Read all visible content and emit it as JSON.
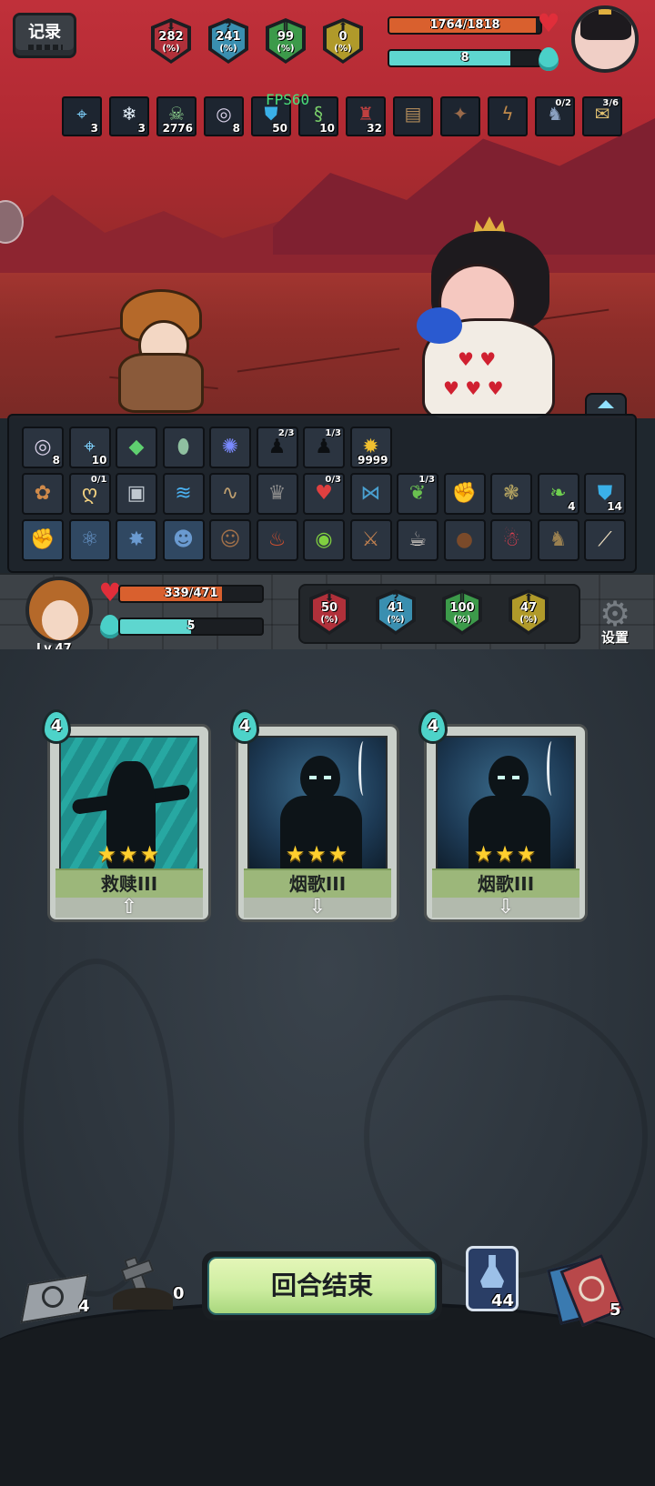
{
  "header": {
    "record_label": "记录",
    "fps": "FPS60"
  },
  "enemy": {
    "hp_text": "1764/1818",
    "hp_fraction": 0.97,
    "energy_value": "8",
    "energy_fraction": 0.8,
    "stats": [
      {
        "value": "282",
        "unit": "(%)",
        "color": "#b0303a",
        "glyph": "⬇",
        "icon": "attack-down-icon"
      },
      {
        "value": "241",
        "unit": "(%)",
        "color": "#3a8fb0",
        "glyph": "?",
        "icon": "mystery-icon"
      },
      {
        "value": "99",
        "unit": "(%)",
        "color": "#3c9a4a",
        "glyph": "⫼",
        "icon": "pillar-icon"
      },
      {
        "value": "0",
        "unit": "(%)",
        "color": "#b09a2a",
        "glyph": "⬆",
        "icon": "attack-up-icon"
      }
    ],
    "status_icons": [
      {
        "icon": "crosshair-icon",
        "glyph": "⌖",
        "count": "3",
        "top": "",
        "color": "#7fd3ff"
      },
      {
        "icon": "snowflake-icon",
        "glyph": "❄",
        "count": "3",
        "top": "",
        "color": "#e8f4ff"
      },
      {
        "icon": "skull-icon",
        "glyph": "☠",
        "count": "2776",
        "top": "",
        "color": "#8fd48f"
      },
      {
        "icon": "ring-icon",
        "glyph": "◎",
        "count": "8",
        "top": "",
        "color": "#d8d0e8"
      },
      {
        "icon": "shield-icon",
        "glyph": "⛊",
        "count": "50",
        "top": "",
        "color": "#3ab0e8"
      },
      {
        "icon": "serpent-icon",
        "glyph": "§",
        "count": "10",
        "top": "",
        "color": "#7ad06a"
      },
      {
        "icon": "hood-icon",
        "glyph": "♜",
        "count": "32",
        "top": "",
        "color": "#c04040"
      },
      {
        "icon": "book-icon",
        "glyph": "▤",
        "count": "",
        "top": "",
        "color": "#b08a5a"
      },
      {
        "icon": "bird-icon",
        "glyph": "✦",
        "count": "",
        "top": "",
        "color": "#9a6a4a"
      },
      {
        "icon": "dragon-icon",
        "glyph": "ϟ",
        "count": "",
        "top": "",
        "color": "#c08a4a"
      },
      {
        "icon": "knight-icon",
        "glyph": "♞",
        "count": "",
        "top": "0/2",
        "color": "#8aa0c0"
      },
      {
        "icon": "scroll-icon",
        "glyph": "✉",
        "count": "",
        "top": "3/6",
        "color": "#e0c070"
      }
    ]
  },
  "player": {
    "level": "Lv.47",
    "hp_text": "339/471",
    "hp_fraction": 0.72,
    "energy_value": "5",
    "energy_fraction": 0.5,
    "stats": [
      {
        "value": "50",
        "unit": "(%)",
        "color": "#b0303a",
        "glyph": "⬇",
        "icon": "attack-down-icon"
      },
      {
        "value": "41",
        "unit": "(%)",
        "color": "#3a8fb0",
        "glyph": "?",
        "icon": "mystery-icon"
      },
      {
        "value": "100",
        "unit": "(%)",
        "color": "#3c9a4a",
        "glyph": "⫼",
        "icon": "pillar-icon"
      },
      {
        "value": "47",
        "unit": "(%)",
        "color": "#b09a2a",
        "glyph": "⬆",
        "icon": "attack-up-icon"
      }
    ],
    "settings_label": "设置"
  },
  "inventory": {
    "rows": [
      [
        {
          "icon": "ring-icon",
          "glyph": "◎",
          "count": "8",
          "top": "",
          "color": "#d8d0e8"
        },
        {
          "icon": "crosshair-icon",
          "glyph": "⌖",
          "count": "10",
          "top": "",
          "color": "#7fd3ff"
        },
        {
          "icon": "green-crystal-icon",
          "glyph": "◆",
          "count": "",
          "top": "",
          "color": "#5fd070"
        },
        {
          "icon": "egg-icon",
          "glyph": "⬮",
          "count": "",
          "top": "",
          "color": "#8fc0a0"
        },
        {
          "icon": "blue-orb-icon",
          "glyph": "✺",
          "count": "",
          "top": "",
          "color": "#7a8aff"
        },
        {
          "icon": "shadow-figure-icon",
          "glyph": "♟",
          "count": "",
          "top": "2/3",
          "color": "#0c0f12"
        },
        {
          "icon": "shadow-figure-icon",
          "glyph": "♟",
          "count": "",
          "top": "1/3",
          "color": "#0c0f12"
        },
        {
          "icon": "gold-coin-icon",
          "glyph": "✹",
          "count": "9999",
          "top": "",
          "color": "#f0c030"
        }
      ],
      [
        {
          "icon": "cookie-icon",
          "glyph": "✿",
          "count": "",
          "top": "",
          "color": "#d08a4a"
        },
        {
          "icon": "pacifier-icon",
          "glyph": "ღ",
          "count": "",
          "top": "0/1",
          "color": "#f0d080"
        },
        {
          "icon": "frame-icon",
          "glyph": "▣",
          "count": "",
          "top": "",
          "color": "#c0c8d0"
        },
        {
          "icon": "wave-icon",
          "glyph": "≋",
          "count": "",
          "top": "",
          "color": "#4ab0f0"
        },
        {
          "icon": "rope-icon",
          "glyph": "∿",
          "count": "",
          "top": "",
          "color": "#c0a070"
        },
        {
          "icon": "crown-icon",
          "glyph": "♛",
          "count": "",
          "top": "",
          "color": "#8a8a8a"
        },
        {
          "icon": "strawberry-icon",
          "glyph": "♥",
          "count": "",
          "top": "0/3",
          "color": "#e04040"
        },
        {
          "icon": "fish-icon",
          "glyph": "⋈",
          "count": "",
          "top": "",
          "color": "#4aa0d0"
        },
        {
          "icon": "plant-icon",
          "glyph": "❦",
          "count": "",
          "top": "1/3",
          "color": "#6ac050"
        },
        {
          "icon": "glove-icon",
          "glyph": "✊",
          "count": "",
          "top": "",
          "color": "#e03040"
        },
        {
          "icon": "toad-icon",
          "glyph": "❃",
          "count": "",
          "top": "",
          "color": "#b0a060"
        },
        {
          "icon": "green-sprout-icon",
          "glyph": "❧",
          "count": "4",
          "top": "",
          "color": "#70d050"
        },
        {
          "icon": "shield-icon",
          "glyph": "⛊",
          "count": "14",
          "top": "",
          "color": "#3ab0e8"
        }
      ],
      [
        {
          "icon": "locked-fist-icon",
          "glyph": "✊",
          "count": "",
          "top": "",
          "color": "#6a9ad0",
          "locked": true
        },
        {
          "icon": "locked-atom-icon",
          "glyph": "⚛",
          "count": "",
          "top": "",
          "color": "#6a9ad0",
          "locked": true
        },
        {
          "icon": "locked-bomb-icon",
          "glyph": "✸",
          "count": "",
          "top": "",
          "color": "#6a9ad0",
          "locked": true
        },
        {
          "icon": "locked-mask-icon",
          "glyph": "☻",
          "count": "",
          "top": "",
          "color": "#6a9ad0",
          "locked": true
        },
        {
          "icon": "monkey-icon",
          "glyph": "☺",
          "count": "",
          "top": "",
          "color": "#a0704a"
        },
        {
          "icon": "bottle-icon",
          "glyph": "♨",
          "count": "",
          "top": "",
          "color": "#d05030"
        },
        {
          "icon": "green-disc-icon",
          "glyph": "◉",
          "count": "",
          "top": "",
          "color": "#80d040"
        },
        {
          "icon": "knife-icon",
          "glyph": "⚔",
          "count": "",
          "top": "",
          "color": "#c08050"
        },
        {
          "icon": "teacup-icon",
          "glyph": "☕",
          "count": "",
          "top": "",
          "color": "#e0d8d0"
        },
        {
          "icon": "sack-icon",
          "glyph": "●",
          "count": "",
          "top": "",
          "color": "#7a4a2a"
        },
        {
          "icon": "red-doll-icon",
          "glyph": "☃",
          "count": "",
          "top": "",
          "color": "#e04050"
        },
        {
          "icon": "bag-icon",
          "glyph": "♞",
          "count": "",
          "top": "",
          "color": "#9a8050"
        },
        {
          "icon": "flute-icon",
          "glyph": "⟋",
          "count": "",
          "top": "",
          "color": "#f0e0c0"
        }
      ]
    ]
  },
  "cards": [
    {
      "cost": "4",
      "name": "救赎III",
      "stars": "★★★",
      "arrow": "⇧",
      "art": "redemption",
      "art_color": "#1f8f8c"
    },
    {
      "cost": "4",
      "name": "烟歌III",
      "stars": "★★★",
      "arrow": "⇩",
      "art": "smoke-song",
      "art_color": "#1d3a55"
    },
    {
      "cost": "4",
      "name": "烟歌III",
      "stars": "★★★",
      "arrow": "⇩",
      "art": "smoke-song",
      "art_color": "#1d3a55"
    }
  ],
  "bottom": {
    "end_turn_label": "回合结束",
    "draw_pile_count": "4",
    "graveyard_count": "0",
    "potion_count": "44",
    "discard_pile_count": "5"
  }
}
